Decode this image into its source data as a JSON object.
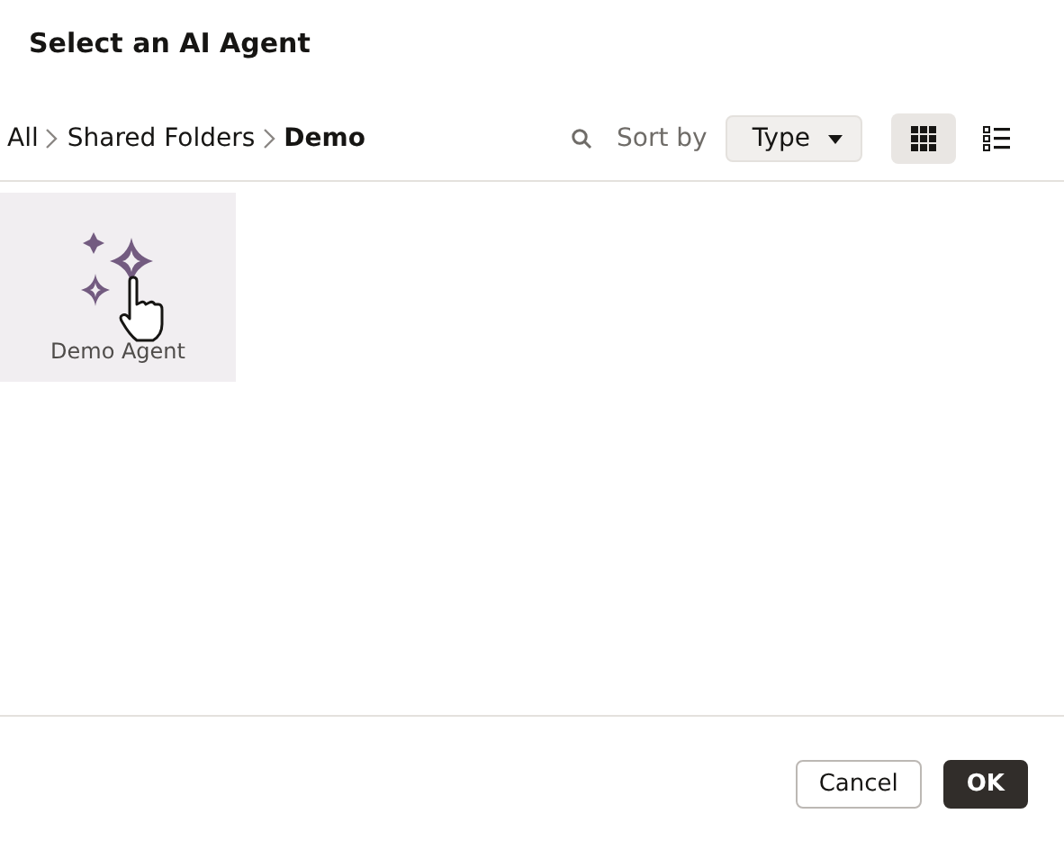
{
  "window": {
    "title": "Select an AI Agent"
  },
  "breadcrumb": [
    {
      "label": "All",
      "current": false
    },
    {
      "label": "Shared Folders",
      "current": false
    },
    {
      "label": "Demo",
      "current": true
    }
  ],
  "sort": {
    "label": "Sort by",
    "value": "Type"
  },
  "views": [
    {
      "kind": "grid",
      "selected": true
    },
    {
      "kind": "list",
      "selected": false
    }
  ],
  "items": [
    {
      "label": "Demo Agent",
      "selected": true
    }
  ],
  "buttons": [
    {
      "label": "Cancel",
      "kind": "secondary"
    },
    {
      "label": "OK",
      "kind": "primary"
    }
  ]
}
